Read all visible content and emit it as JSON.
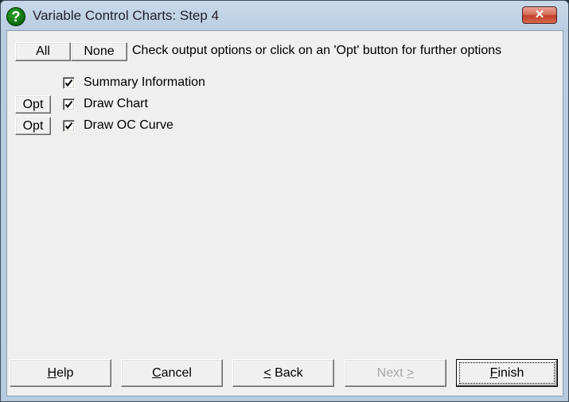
{
  "window": {
    "title": "Variable Control Charts: Step 4",
    "icon": "question-icon",
    "close_icon": "close-icon"
  },
  "toolbar": {
    "all_label": "All",
    "none_label": "None",
    "hint": "Check output options or click on an 'Opt' button for further options"
  },
  "options": [
    {
      "label": "Summary Information",
      "checked": true,
      "has_opt": false
    },
    {
      "label": "Draw Chart",
      "checked": true,
      "has_opt": true,
      "opt_label": "Opt"
    },
    {
      "label": "Draw OC Curve",
      "checked": true,
      "has_opt": true,
      "opt_label": "Opt"
    }
  ],
  "footer": {
    "help": {
      "mnemonic": "H",
      "rest": "elp"
    },
    "cancel": {
      "mnemonic": "C",
      "rest": "ancel"
    },
    "back": {
      "mnemonic": "<",
      "rest": " Back"
    },
    "next": {
      "prefix": "Next ",
      "mnemonic": ">",
      "disabled": true
    },
    "finish": {
      "mnemonic": "F",
      "rest": "inish",
      "default": true
    }
  }
}
